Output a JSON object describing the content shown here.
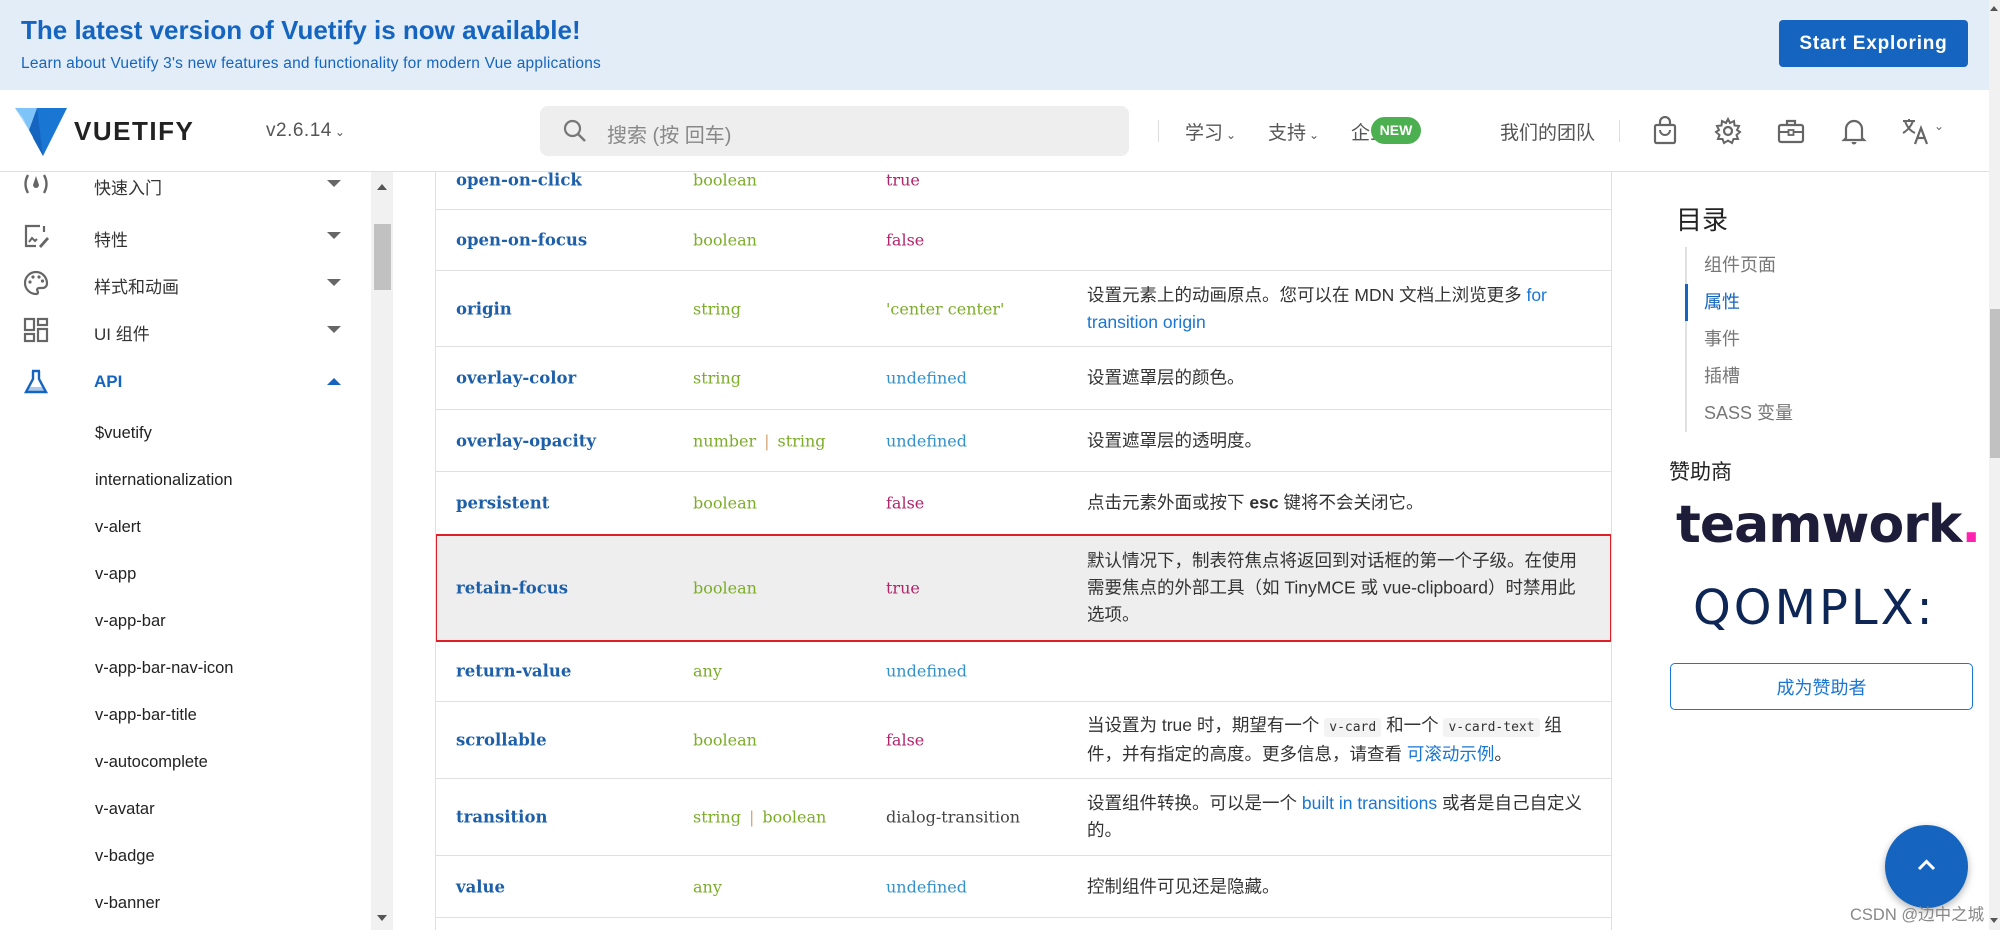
{
  "banner": {
    "title": "The latest version of Vuetify is now available!",
    "subtitle": "Learn about Vuetify 3's new features and functionality for modern Vue applications",
    "cta_label": "Start Exploring"
  },
  "header": {
    "logo_text": "VUETIFY",
    "version": "v2.6.14",
    "search_placeholder": "搜索 (按 回车)",
    "nav": [
      {
        "label": "学习",
        "dropdown": true
      },
      {
        "label": "支持",
        "dropdown": true
      },
      {
        "label": "企业版",
        "badge": "NEW"
      },
      {
        "label": "我们的团队"
      }
    ],
    "icons": [
      "shopping-bag-icon",
      "gear-icon",
      "briefcase-icon",
      "bell-icon",
      "translate-icon"
    ]
  },
  "sidebar": {
    "groups": [
      {
        "label": "快速入门",
        "icon": "speedometer-icon",
        "expanded": false
      },
      {
        "label": "特性",
        "icon": "image-edit-icon",
        "expanded": false
      },
      {
        "label": "样式和动画",
        "icon": "palette-icon",
        "expanded": false
      },
      {
        "label": "UI 组件",
        "icon": "view-dashboard-icon",
        "expanded": false
      },
      {
        "label": "API",
        "icon": "flask-icon",
        "expanded": true
      }
    ],
    "api_items": [
      "$vuetify",
      "internationalization",
      "v-alert",
      "v-app",
      "v-app-bar",
      "v-app-bar-nav-icon",
      "v-app-bar-title",
      "v-autocomplete",
      "v-avatar",
      "v-badge",
      "v-banner"
    ]
  },
  "props_table": {
    "rows": [
      {
        "name": "open-on-click",
        "types": [
          "boolean"
        ],
        "default": "true",
        "default_kind": "bool",
        "desc": ""
      },
      {
        "name": "open-on-focus",
        "types": [
          "boolean"
        ],
        "default": "false",
        "default_kind": "bool",
        "desc": ""
      },
      {
        "name": "origin",
        "types": [
          "string"
        ],
        "default": "'center center'",
        "default_kind": "str",
        "desc": "设置元素上的动画原点。您可以在 MDN 文档上浏览更多 ",
        "desc_link": "for transition origin"
      },
      {
        "name": "overlay-color",
        "types": [
          "string"
        ],
        "default": "undefined",
        "default_kind": "undef",
        "desc": "设置遮罩层的颜色。"
      },
      {
        "name": "overlay-opacity",
        "types": [
          "number",
          "string"
        ],
        "default": "undefined",
        "default_kind": "undef",
        "desc": "设置遮罩层的透明度。"
      },
      {
        "name": "persistent",
        "types": [
          "boolean"
        ],
        "default": "false",
        "default_kind": "bool",
        "desc_pre": "点击元素外面或按下 ",
        "desc_bold": "esc",
        "desc_post": " 键将不会关闭它。"
      },
      {
        "name": "retain-focus",
        "types": [
          "boolean"
        ],
        "default": "true",
        "default_kind": "bool",
        "desc": "默认情况下，制表符焦点将返回到对话框的第一个子级。在使用需要焦点的外部工具（如 TinyMCE 或 vue-clipboard）时禁用此选项。",
        "highlighted": true
      },
      {
        "name": "return-value",
        "types": [
          "any"
        ],
        "default": "undefined",
        "default_kind": "undef",
        "desc": ""
      },
      {
        "name": "scrollable",
        "types": [
          "boolean"
        ],
        "default": "false",
        "default_kind": "bool",
        "desc_pre": "当设置为 true 时，期望有一个 ",
        "code1": "v-card",
        "desc_mid": " 和一个 ",
        "code2": "v-card-text",
        "desc_post": " 组件，并有指定的高度。更多信息，请查看 ",
        "desc_link": "可滚动示例",
        "desc_end": "。"
      },
      {
        "name": "transition",
        "types": [
          "string",
          "boolean"
        ],
        "default": "dialog-transition",
        "default_kind": "plain",
        "desc_pre": "设置组件转换。可以是一个 ",
        "desc_link": "built in transitions",
        "desc_post": " 或者是自己自定义的。"
      },
      {
        "name": "value",
        "types": [
          "any"
        ],
        "default": "undefined",
        "default_kind": "undef",
        "desc": "控制组件可见还是隐藏。"
      }
    ]
  },
  "toc": {
    "title": "目录",
    "items": [
      {
        "label": "组件页面",
        "active": false
      },
      {
        "label": "属性",
        "active": true
      },
      {
        "label": "事件",
        "active": false
      },
      {
        "label": "插槽",
        "active": false
      },
      {
        "label": "SASS 变量",
        "active": false
      }
    ]
  },
  "sponsors": {
    "title": "赞助商",
    "names": [
      "teamwork",
      "QOMPLX:"
    ],
    "become_label": "成为赞助者"
  },
  "watermark": "CSDN @边中之城",
  "colors": {
    "primary": "#1565c0",
    "banner_bg": "#e3edf7",
    "new_badge": "#4caf50",
    "highlight_border": "#e01e25"
  }
}
